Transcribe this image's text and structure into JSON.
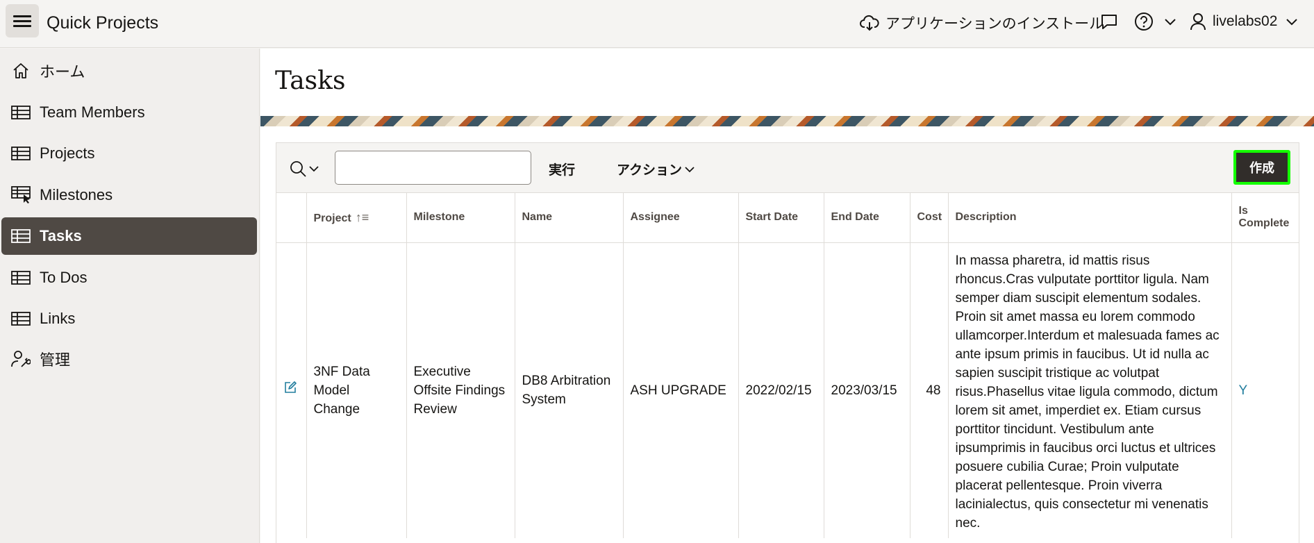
{
  "header": {
    "app_title": "Quick Projects",
    "install_label": "アプリケーションのインストール",
    "username": "livelabs02"
  },
  "sidebar": {
    "items": [
      {
        "label": "ホーム",
        "icon": "home-icon"
      },
      {
        "label": "Team Members",
        "icon": "table-icon"
      },
      {
        "label": "Projects",
        "icon": "table-icon"
      },
      {
        "label": "Milestones",
        "icon": "table-pointer-icon"
      },
      {
        "label": "Tasks",
        "icon": "table-icon",
        "active": true
      },
      {
        "label": "To Dos",
        "icon": "table-icon"
      },
      {
        "label": "Links",
        "icon": "table-icon"
      },
      {
        "label": "管理",
        "icon": "user-wrench-icon"
      }
    ]
  },
  "main": {
    "page_title": "Tasks",
    "toolbar": {
      "search_value": "",
      "go_label": "実行",
      "actions_label": "アクション",
      "create_label": "作成"
    },
    "columns": [
      "Project",
      "Milestone",
      "Name",
      "Assignee",
      "Start Date",
      "End Date",
      "Cost",
      "Description",
      "Is Complete"
    ],
    "rows": [
      {
        "project": "3NF Data Model Change",
        "milestone": "Executive Offsite Findings Review",
        "name": "DB8 Arbitration System",
        "assignee": "ASH UPGRADE",
        "start_date": "2022/02/15",
        "end_date": "2023/03/15",
        "cost": "48",
        "description": "In massa pharetra, id mattis risus rhoncus.Cras vulputate porttitor ligula. Nam semper diam suscipit elementum sodales. Proin sit amet massa eu lorem commodo ullamcorper.Interdum et malesuada fames ac ante ipsum primis in faucibus. Ut id nulla ac sapien suscipit tristique ac volutpat risus.Phasellus vitae ligula commodo, dictum lorem sit amet, imperdiet ex. Etiam cursus porttitor tincidunt. Vestibulum ante ipsumprimis in faucibus orci luctus et ultrices posuere cubilia Curae; Proin vulputate placerat pellentesque. Proin viverra lacinialectus, quis consectetur mi venenatis nec.",
        "is_complete": "Y"
      }
    ]
  },
  "colors": {
    "accent_active": "#4f4944",
    "create_button": "#312d2a",
    "highlight_border": "#14ff00",
    "link": "#227e9e"
  }
}
